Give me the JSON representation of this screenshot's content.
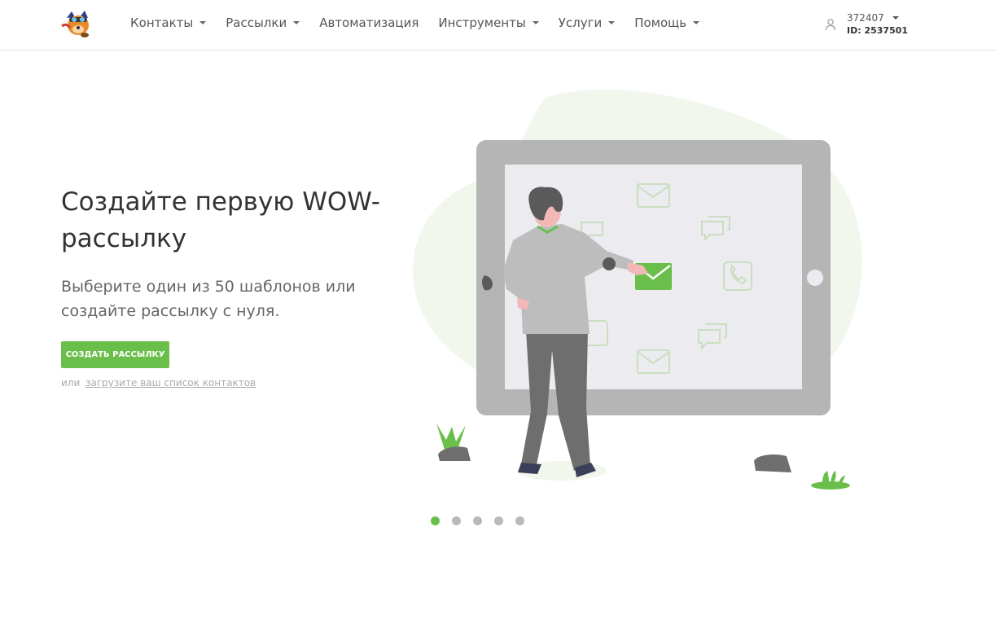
{
  "header": {
    "nav": [
      {
        "label": "Контакты",
        "has_dropdown": true
      },
      {
        "label": "Рассылки",
        "has_dropdown": true
      },
      {
        "label": "Автоматизация",
        "has_dropdown": false
      },
      {
        "label": "Инструменты",
        "has_dropdown": true
      },
      {
        "label": "Услуги",
        "has_dropdown": true
      },
      {
        "label": "Помощь",
        "has_dropdown": true
      }
    ],
    "account": {
      "name": "372407",
      "id_text": "ID: 2537501",
      "icon": "user-icon"
    }
  },
  "hero": {
    "title": "Создайте первую WOW-рассылку",
    "subtitle": "Выберите один из 50 шаблонов или создайте рассылку с нуля.",
    "cta_label": "СОЗДАТЬ РАССЫЛКУ",
    "alt_prefix": "или",
    "alt_link": "загрузите ваш список контактов"
  },
  "carousel": {
    "total": 5,
    "active_index": 0
  },
  "colors": {
    "accent": "#6abf4b",
    "nav_text": "#555555",
    "dot_inactive": "#b9b9b9"
  }
}
